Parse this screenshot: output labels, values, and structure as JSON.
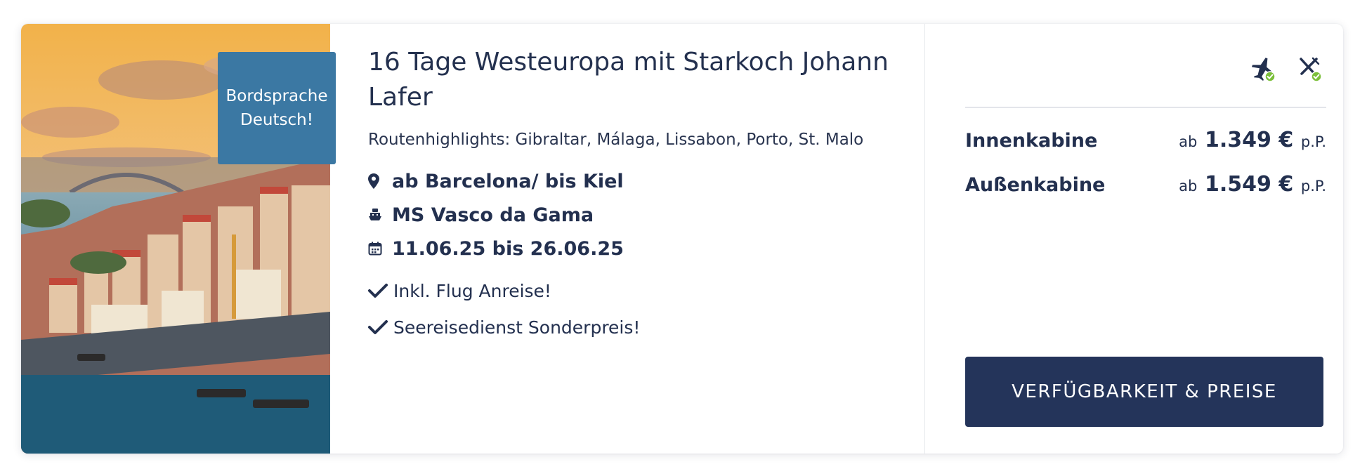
{
  "offer": {
    "badge": "Bordsprache\nDeutsch!",
    "title": "16 Tage Westeuropa mit Starkoch Johann Lafer",
    "highlights": "Routenhighlights: Gibraltar, Málaga, Lissabon, Porto, St. Malo",
    "route": "ab Barcelona/ bis Kiel",
    "ship": "MS Vasco da Gama",
    "dates": "11.06.25 bis 26.06.25",
    "features": [
      "Inkl. Flug Anreise!",
      "Seereisedienst Sonderpreis!"
    ]
  },
  "feature_icons": [
    "flight-included-icon",
    "dining-included-icon"
  ],
  "prices": [
    {
      "cabin": "Innenkabine",
      "prefix": "ab",
      "amount": "1.349 €",
      "suffix": "p.P."
    },
    {
      "cabin": "Außenkabine",
      "prefix": "ab",
      "amount": "1.549 €",
      "suffix": "p.P."
    }
  ],
  "cta_label": "VERFÜGBARKEIT & PREISE",
  "colors": {
    "primary_text": "#23304f",
    "badge_bg": "#3b78a3",
    "cta_bg": "#24345a",
    "check_green": "#7bbf3a"
  }
}
